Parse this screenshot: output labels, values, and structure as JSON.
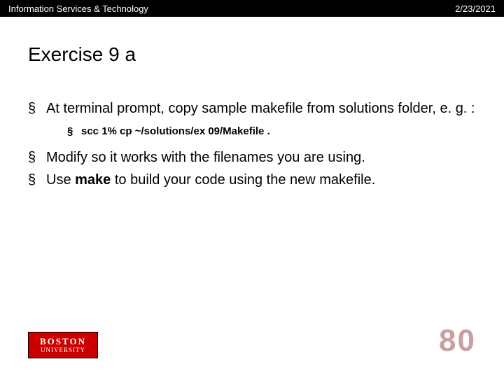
{
  "header": {
    "left": "Information Services & Technology",
    "right": "2/23/2021"
  },
  "title": "Exercise 9 a",
  "bullets": {
    "b1": "At terminal prompt, copy sample makefile from solutions folder, e. g. :",
    "sub1": "scc 1%  cp ~/solutions/ex 09/Makefile .",
    "b2": "Modify so it works with the filenames you are using.",
    "b3_pre": "Use ",
    "b3_bold": "make",
    "b3_post": " to build your code using the new makefile."
  },
  "logo": {
    "line1": "BOSTON",
    "line2": "UNIVERSITY"
  },
  "page_number": "80"
}
